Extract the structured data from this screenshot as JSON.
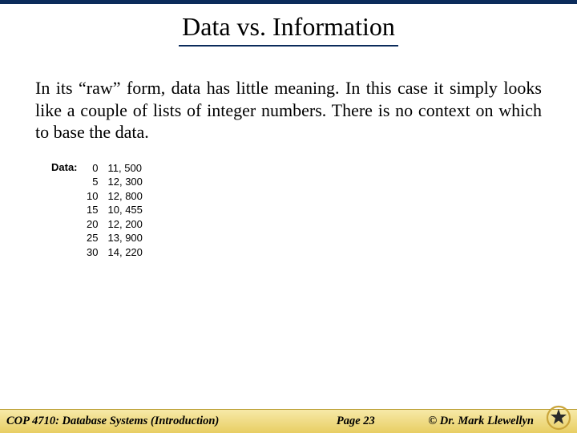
{
  "title": "Data vs. Information",
  "paragraph": "In its “raw” form, data has little meaning.  In this case it simply looks like a couple of lists of integer numbers.  There is no context on which to base the data.",
  "data_label": "Data:",
  "data_rows": {
    "left": [
      "0",
      "5",
      "10",
      "15",
      "20",
      "25",
      "30"
    ],
    "right": [
      "11, 500",
      "12, 300",
      "12, 800",
      "10, 455",
      "12, 200",
      "13, 900",
      "14, 220"
    ]
  },
  "footer": {
    "left": "COP 4710: Database Systems  (Introduction)",
    "mid": "Page 23",
    "right": "©  Dr. Mark Llewellyn"
  }
}
